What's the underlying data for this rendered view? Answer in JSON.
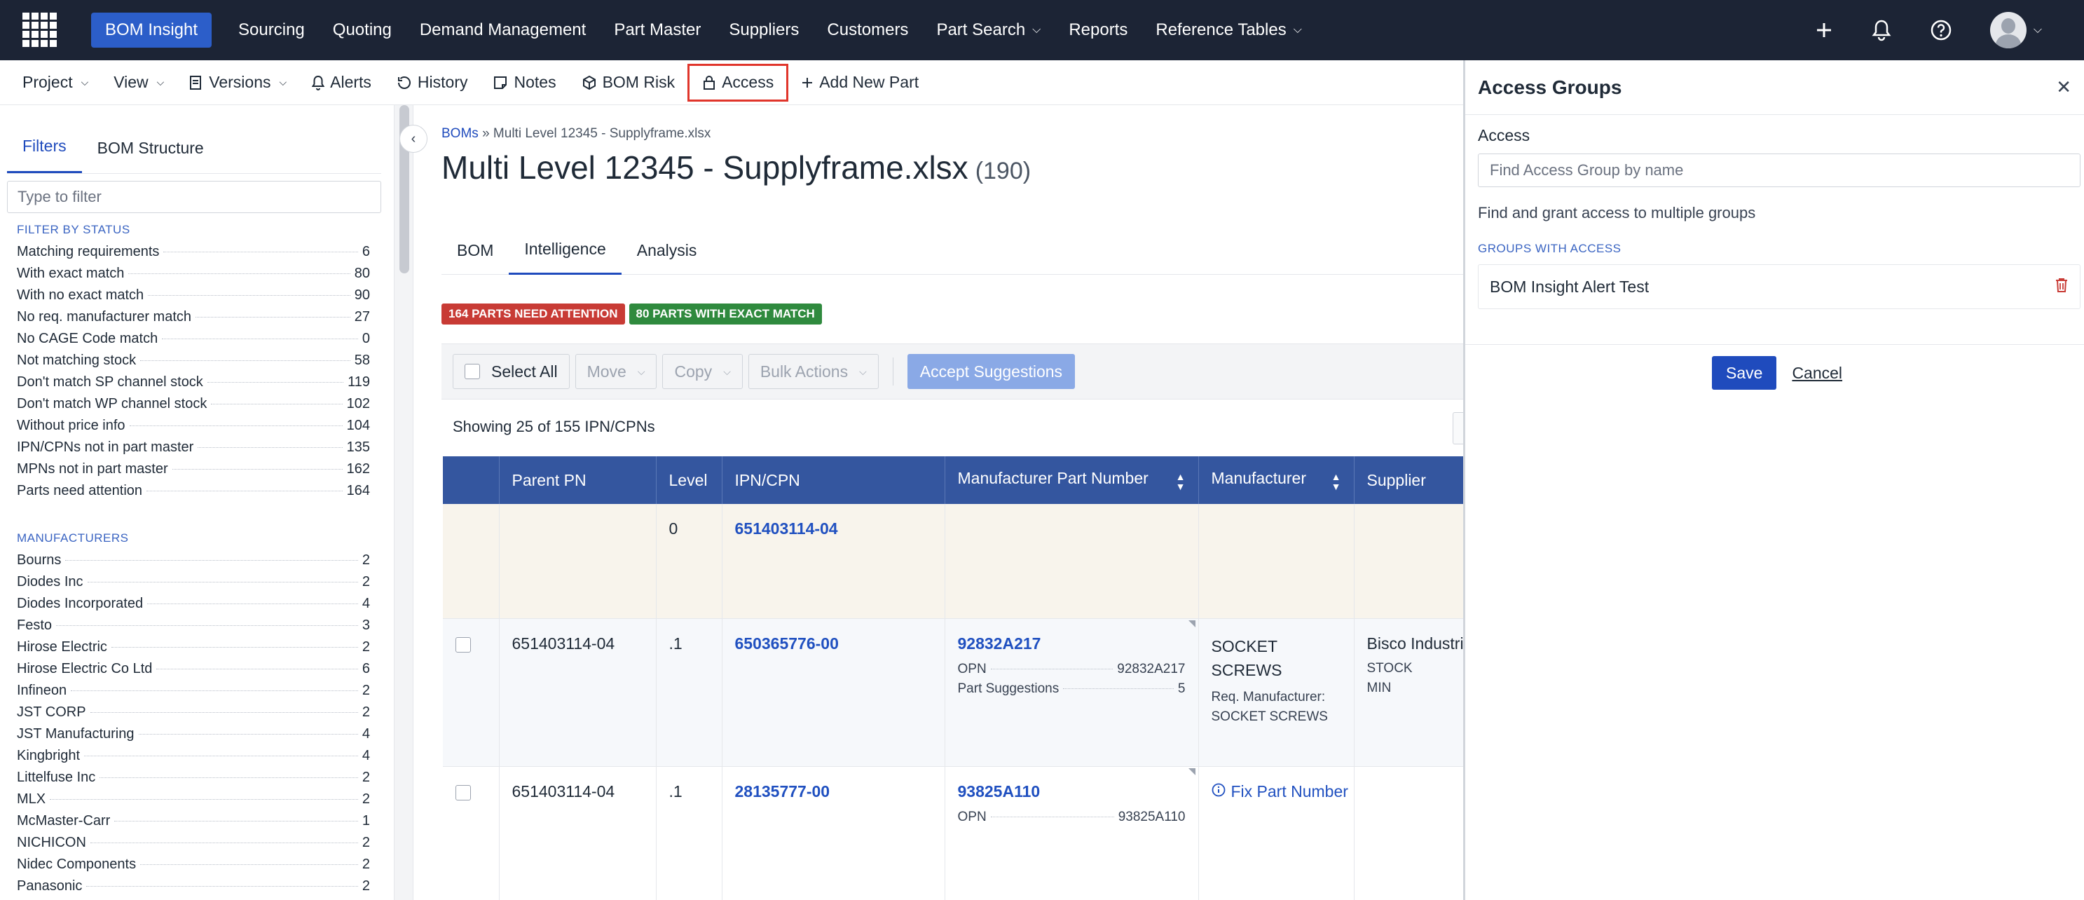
{
  "topnav": {
    "items": [
      {
        "label": "BOM Insight",
        "active": true
      },
      {
        "label": "Sourcing"
      },
      {
        "label": "Quoting"
      },
      {
        "label": "Demand Management"
      },
      {
        "label": "Part Master"
      },
      {
        "label": "Suppliers"
      },
      {
        "label": "Customers"
      },
      {
        "label": "Part Search",
        "dropdown": true
      },
      {
        "label": "Reports"
      },
      {
        "label": "Reference Tables",
        "dropdown": true
      }
    ],
    "icons": [
      "plus-icon",
      "bell-icon",
      "help-icon",
      "avatar"
    ]
  },
  "toolbar": {
    "project": "Project",
    "view": "View",
    "versions": "Versions",
    "alerts": "Alerts",
    "history": "History",
    "notes": "Notes",
    "bom_risk": "BOM Risk",
    "access": "Access",
    "add_new_part": "Add New Part"
  },
  "sidebar": {
    "tabs": [
      "Filters",
      "BOM Structure"
    ],
    "filter_placeholder": "Type to filter",
    "status_heading": "FILTER BY STATUS",
    "status_filters": [
      {
        "label": "Matching requirements",
        "count": "6"
      },
      {
        "label": "With exact match",
        "count": "80"
      },
      {
        "label": "With no exact match",
        "count": "90"
      },
      {
        "label": "No req. manufacturer match",
        "count": "27"
      },
      {
        "label": "No CAGE Code match",
        "count": "0"
      },
      {
        "label": "Not matching stock",
        "count": "58"
      },
      {
        "label": "Don't match SP channel stock",
        "count": "119"
      },
      {
        "label": "Don't match WP channel stock",
        "count": "102"
      },
      {
        "label": "Without price info",
        "count": "104"
      },
      {
        "label": "IPN/CPNs not in part master",
        "count": "135"
      },
      {
        "label": "MPNs not in part master",
        "count": "162"
      },
      {
        "label": "Parts need attention",
        "count": "164"
      }
    ],
    "manufacturers_heading": "MANUFACTURERS",
    "manufacturers": [
      {
        "label": "Bourns",
        "count": "2"
      },
      {
        "label": "Diodes Inc",
        "count": "2"
      },
      {
        "label": "Diodes Incorporated",
        "count": "4"
      },
      {
        "label": "Festo",
        "count": "3"
      },
      {
        "label": "Hirose Electric",
        "count": "2"
      },
      {
        "label": "Hirose Electric Co Ltd",
        "count": "6"
      },
      {
        "label": "Infineon",
        "count": "2"
      },
      {
        "label": "JST CORP",
        "count": "2"
      },
      {
        "label": "JST Manufacturing",
        "count": "4"
      },
      {
        "label": "Kingbright",
        "count": "4"
      },
      {
        "label": "Littelfuse Inc",
        "count": "2"
      },
      {
        "label": "MLX",
        "count": "2"
      },
      {
        "label": "McMaster-Carr",
        "count": "1"
      },
      {
        "label": "NICHICON",
        "count": "2"
      },
      {
        "label": "Nidec Components",
        "count": "2"
      },
      {
        "label": "Panasonic",
        "count": "2"
      }
    ]
  },
  "main": {
    "breadcrumb_link": "BOMs",
    "breadcrumb_sep": "»",
    "breadcrumb_current": "Multi Level 12345 - Supplyframe.xlsx",
    "title": "Multi Level 12345 - Supplyframe.xlsx",
    "title_count": "(190)",
    "tabs": [
      "BOM",
      "Intelligence",
      "Analysis"
    ],
    "active_tab": "Intelligence",
    "badge_attention": "164 PARTS NEED ATTENTION",
    "badge_exact": "80 PARTS WITH EXACT MATCH",
    "select_all": "Select All",
    "move": "Move",
    "copy": "Copy",
    "bulk_actions": "Bulk Actions",
    "accept_suggestions": "Accept Suggestions",
    "showing": "Showing 25 of 155 IPN/CPNs"
  },
  "table": {
    "headers": {
      "parent_pn": "Parent PN",
      "level": "Level",
      "ipn_cpn": "IPN/CPN",
      "mpn": "Manufacturer Part Number",
      "manufacturer": "Manufacturer",
      "supplier": "Supplier"
    },
    "rows": [
      {
        "parent_pn": "",
        "level": "0",
        "ipn": "651403114-04"
      },
      {
        "parent_pn": "651403114-04",
        "level": ".1",
        "ipn": "650365776-00",
        "mpn": "92832A217",
        "opn_label": "OPN",
        "opn_value": "92832A217",
        "sugg_label": "Part Suggestions",
        "sugg_value": "5",
        "manufacturer": "SOCKET SCREWS",
        "req_mfr_label": "Req. Manufacturer:",
        "req_mfr_value": "SOCKET SCREWS",
        "supplier": "Bisco Industries",
        "stock_label": "STOCK",
        "min_label": "MIN"
      },
      {
        "parent_pn": "651403114-04",
        "level": ".1",
        "ipn": "28135777-00",
        "mpn": "93825A110",
        "opn_label": "OPN",
        "opn_value": "93825A110",
        "fix_label": "Fix Part Number"
      }
    ]
  },
  "panel": {
    "title": "Access Groups",
    "access_label": "Access",
    "search_placeholder": "Find Access Group by name",
    "help_text": "Find and grant access to multiple groups",
    "groups_heading": "GROUPS WITH ACCESS",
    "groups": [
      "BOM Insight Alert Test"
    ],
    "save": "Save",
    "cancel": "Cancel"
  },
  "colors": {
    "nav_bg": "#1c2435",
    "brand_active": "#2c5ec9",
    "table_header": "#34569f",
    "badge_red": "#c83b35",
    "badge_green": "#2f8a3e",
    "highlight_border": "#e0352b",
    "save_button": "#1f4bbd"
  }
}
